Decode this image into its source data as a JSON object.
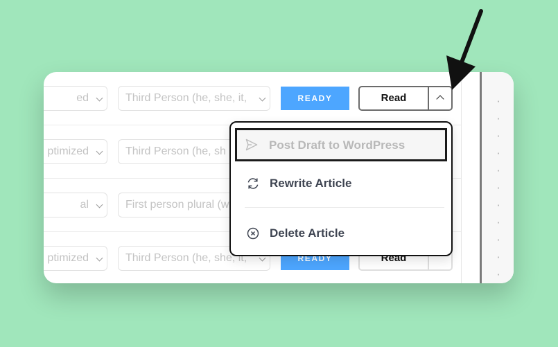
{
  "rows": [
    {
      "tone": "ed",
      "pov": "Third Person (he, she, it, ",
      "status": "READY",
      "action": "Read"
    },
    {
      "tone": "ptimized",
      "pov": "Third Person (he, sh",
      "status": "",
      "action": ""
    },
    {
      "tone": "al",
      "pov": "First person plural (w",
      "status": "",
      "action": ""
    },
    {
      "tone": "ptimized",
      "pov": "Third Person (he, she, it, ",
      "status": "READY",
      "action": "Read"
    }
  ],
  "menu": {
    "post_label": "Post Draft to WordPress",
    "rewrite_label": "Rewrite Article",
    "delete_label": "Delete Article"
  },
  "icons": {
    "post": "send-icon",
    "rewrite": "refresh-icon",
    "delete": "close-circle-icon",
    "toggle": "chevron-up-icon",
    "more": "more-vertical-icon"
  },
  "colors": {
    "background": "#a0e6bb",
    "ready_badge": "#4da6ff",
    "arrow": "#111111"
  }
}
